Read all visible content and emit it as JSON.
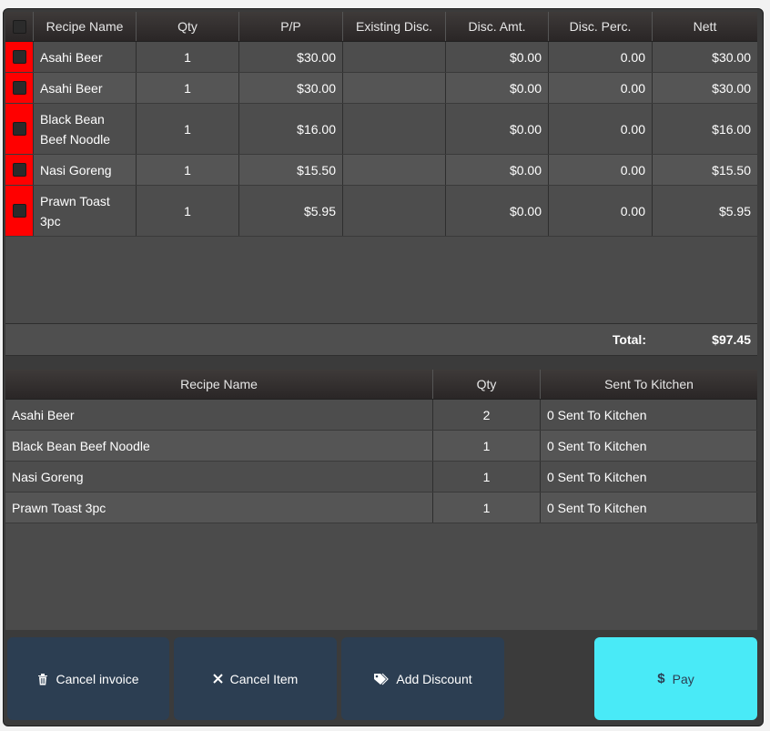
{
  "invoice": {
    "columns": {
      "name": "Recipe Name",
      "qty": "Qty",
      "pp": "P/P",
      "existing": "Existing Disc.",
      "disc_amt": "Disc. Amt.",
      "disc_perc": "Disc. Perc.",
      "nett": "Nett"
    },
    "rows": [
      {
        "name_lines": [
          "Asahi Beer"
        ],
        "qty": "1",
        "pp": "$30.00",
        "existing": "",
        "disc_amt": "$0.00",
        "disc_perc": "0.00",
        "nett": "$30.00"
      },
      {
        "name_lines": [
          "Asahi Beer"
        ],
        "qty": "1",
        "pp": "$30.00",
        "existing": "",
        "disc_amt": "$0.00",
        "disc_perc": "0.00",
        "nett": "$30.00"
      },
      {
        "name_lines": [
          "Black Bean",
          "Beef Noodle"
        ],
        "qty": "1",
        "pp": "$16.00",
        "existing": "",
        "disc_amt": "$0.00",
        "disc_perc": "0.00",
        "nett": "$16.00"
      },
      {
        "name_lines": [
          "Nasi Goreng"
        ],
        "qty": "1",
        "pp": "$15.50",
        "existing": "",
        "disc_amt": "$0.00",
        "disc_perc": "0.00",
        "nett": "$15.50"
      },
      {
        "name_lines": [
          "Prawn Toast",
          "3pc"
        ],
        "qty": "1",
        "pp": "$5.95",
        "existing": "",
        "disc_amt": "$0.00",
        "disc_perc": "0.00",
        "nett": "$5.95"
      }
    ],
    "total_label": "Total:",
    "total_value": "$97.45"
  },
  "kitchen": {
    "columns": {
      "name": "Recipe Name",
      "qty": "Qty",
      "sent": "Sent To Kitchen"
    },
    "rows": [
      {
        "name": "Asahi Beer",
        "qty": "2",
        "sent": "0 Sent To Kitchen"
      },
      {
        "name": "Black Bean Beef Noodle",
        "qty": "1",
        "sent": "0 Sent To Kitchen"
      },
      {
        "name": "Nasi Goreng",
        "qty": "1",
        "sent": "0 Sent To Kitchen"
      },
      {
        "name": "Prawn Toast 3pc",
        "qty": "1",
        "sent": "0 Sent To Kitchen"
      }
    ]
  },
  "actions": {
    "cancel_invoice": "Cancel invoice",
    "cancel_item": "Cancel Item",
    "add_discount": "Add Discount",
    "pay": "Pay"
  },
  "colors": {
    "row_marker": "#ff0000",
    "button": "#2c3e52",
    "pay_button": "#49eaf7"
  },
  "icons": {
    "cancel_invoice": "trash-icon",
    "cancel_item": "close-icon",
    "add_discount": "tag-icon",
    "pay": "dollar-icon"
  }
}
